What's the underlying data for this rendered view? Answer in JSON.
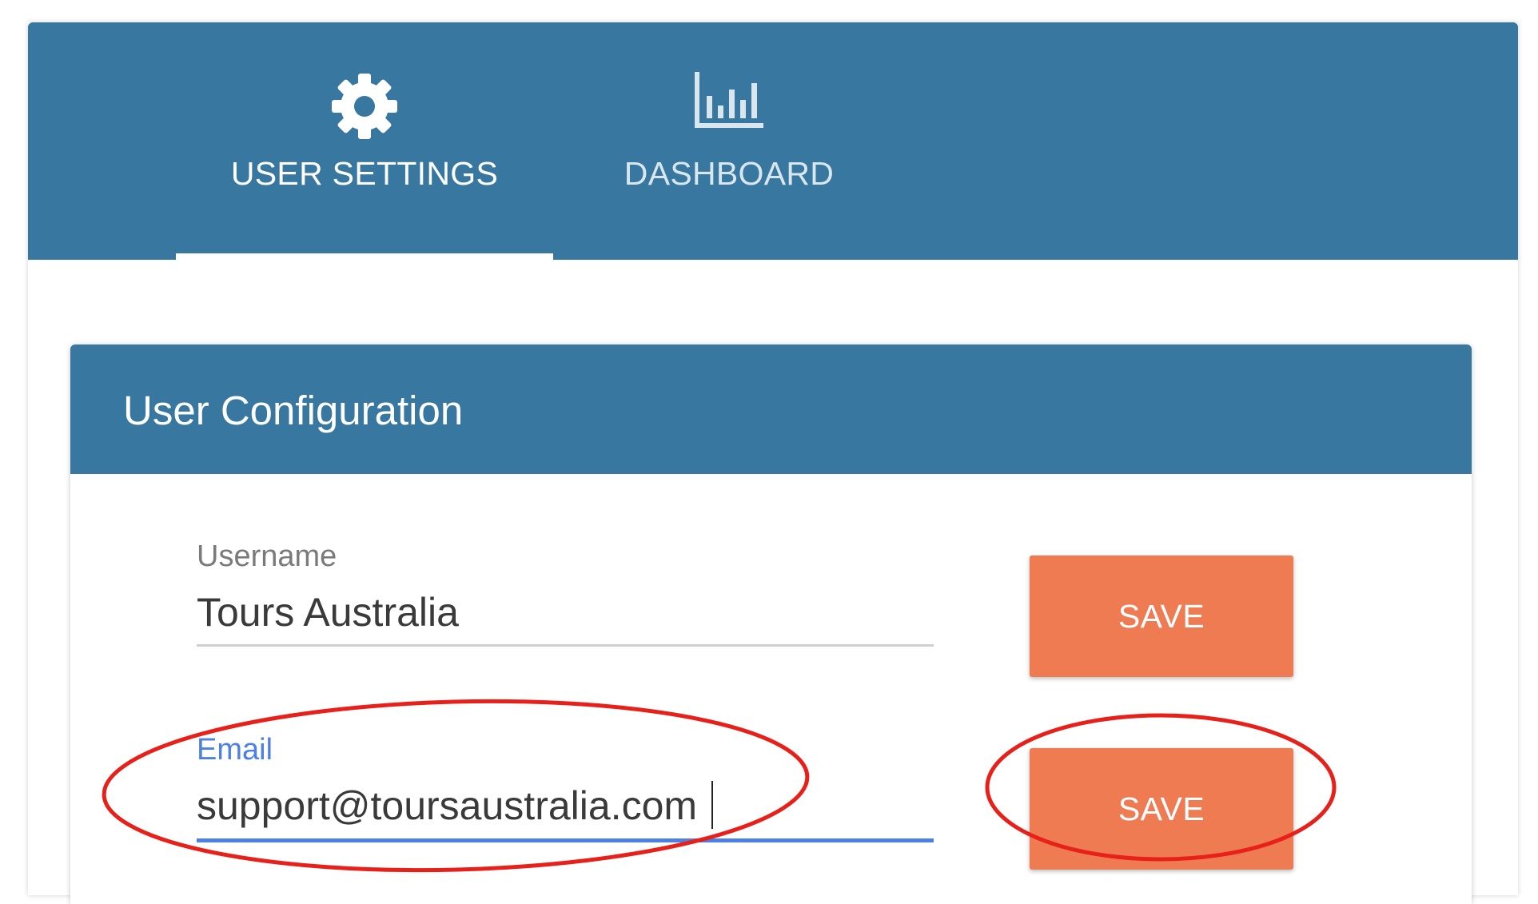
{
  "colors": {
    "primary": "#3777a0",
    "accent_button": "#ef7b52",
    "focus": "#4d80e4",
    "label_gray": "#7a7a7a",
    "underline_gray": "#cfcfcf",
    "annotation": "#e8201a",
    "active_tab_text": "#ffffff",
    "inactive_tab_text": "#d9e6ee"
  },
  "tabs": [
    {
      "label": "USER SETTINGS",
      "icon": "gear-icon",
      "active": true
    },
    {
      "label": "DASHBOARD",
      "icon": "bar-chart-icon",
      "active": false
    }
  ],
  "card": {
    "title": "User Configuration"
  },
  "fields": {
    "username": {
      "label": "Username",
      "value": "Tours Australia",
      "focused": false
    },
    "email": {
      "label": "Email",
      "value": "support@toursaustralia.com",
      "focused": true
    }
  },
  "buttons": {
    "save_username_label": "SAVE",
    "save_email_label": "SAVE"
  }
}
